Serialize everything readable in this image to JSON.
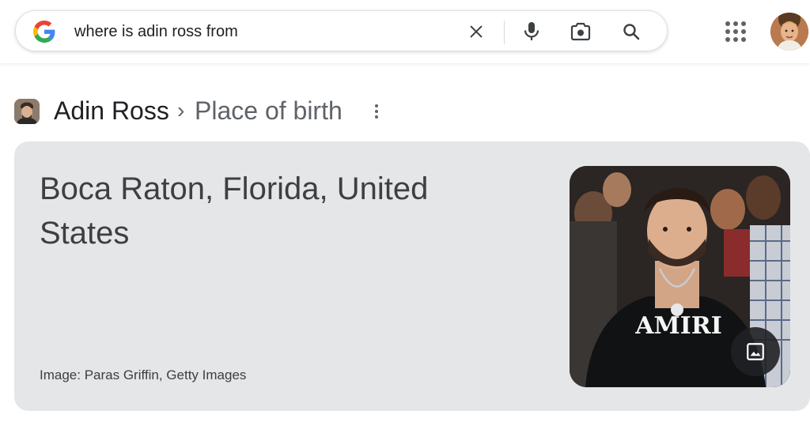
{
  "search": {
    "query": "where is adin ross from"
  },
  "header": {
    "icons": [
      "google-logo-icon",
      "clear-icon",
      "microphone-icon",
      "lens-camera-icon",
      "search-icon",
      "apps-grid-icon",
      "account-avatar"
    ]
  },
  "knowledge_panel": {
    "entity": "Adin Ross",
    "separator": "›",
    "attribute": "Place of birth",
    "answer": "Boca Raton, Florida, United States",
    "image_credit": "Image: Paras Griffin, Getty Images",
    "shirt_text": "AMIRI"
  },
  "colors": {
    "google_blue": "#4285F4",
    "google_red": "#EA4335",
    "google_yellow": "#FBBC05",
    "google_green": "#34A853",
    "card_bg": "#e5e6e8",
    "icon_gray": "#5f6368"
  }
}
